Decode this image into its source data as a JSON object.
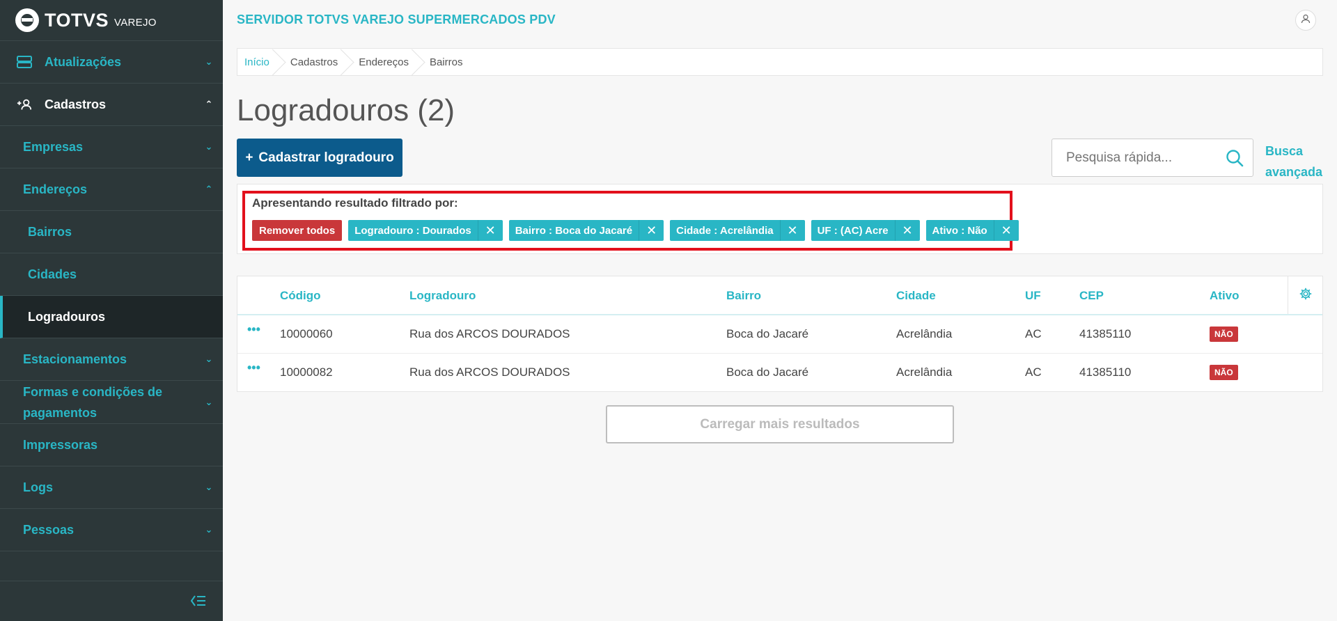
{
  "brand": {
    "name": "TOTVS",
    "sub": "VAREJO"
  },
  "sidebar": {
    "items": [
      {
        "label": "Atualizações",
        "icon": "server-icon",
        "level": 0,
        "state": "collapsed"
      },
      {
        "label": "Cadastros",
        "icon": "add-user-icon",
        "level": 0,
        "state": "expanded"
      },
      {
        "label": "Empresas",
        "level": 1,
        "state": "collapsed"
      },
      {
        "label": "Endereços",
        "level": 1,
        "state": "expanded"
      },
      {
        "label": "Bairros",
        "level": 2
      },
      {
        "label": "Cidades",
        "level": 2
      },
      {
        "label": "Logradouros",
        "level": 2,
        "active": true
      },
      {
        "label": "Estacionamentos",
        "level": 1,
        "state": "collapsed"
      },
      {
        "label": "Formas e condições de pagamentos",
        "level": 1,
        "state": "collapsed"
      },
      {
        "label": "Impressoras",
        "level": 1
      },
      {
        "label": "Logs",
        "level": 1,
        "state": "collapsed"
      },
      {
        "label": "Pessoas",
        "level": 1,
        "state": "collapsed"
      }
    ]
  },
  "header": {
    "title": "SERVIDOR TOTVS VAREJO SUPERMERCADOS PDV"
  },
  "breadcrumb": [
    "Início",
    "Cadastros",
    "Endereços",
    "Bairros"
  ],
  "page": {
    "title": "Logradouros (2)",
    "primary_button": "Cadastrar logradouro",
    "search_placeholder": "Pesquisa rápida...",
    "advanced_search": "Busca avançada"
  },
  "filters": {
    "title": "Apresentando resultado filtrado por:",
    "remove_all": "Remover todos",
    "tags": [
      "Logradouro : Dourados",
      "Bairro : Boca do Jacaré",
      "Cidade : Acrelândia",
      "UF : (AC) Acre",
      "Ativo : Não"
    ]
  },
  "table": {
    "columns": [
      "Código",
      "Logradouro",
      "Bairro",
      "Cidade",
      "UF",
      "CEP",
      "Ativo"
    ],
    "rows": [
      {
        "codigo": "10000060",
        "logradouro": "Rua dos ARCOS DOURADOS",
        "bairro": "Boca do Jacaré",
        "cidade": "Acrelândia",
        "uf": "AC",
        "cep": "41385110",
        "ativo": "NÃO"
      },
      {
        "codigo": "10000082",
        "logradouro": "Rua dos ARCOS DOURADOS",
        "bairro": "Boca do Jacaré",
        "cidade": "Acrelândia",
        "uf": "AC",
        "cep": "41385110",
        "ativo": "NÃO"
      }
    ]
  },
  "load_more": "Carregar mais resultados",
  "colors": {
    "accent": "#29b6c5",
    "primary": "#0c5b8c",
    "danger": "#c9373a",
    "sidebar": "#2c3739",
    "highlight": "#e2101c"
  }
}
